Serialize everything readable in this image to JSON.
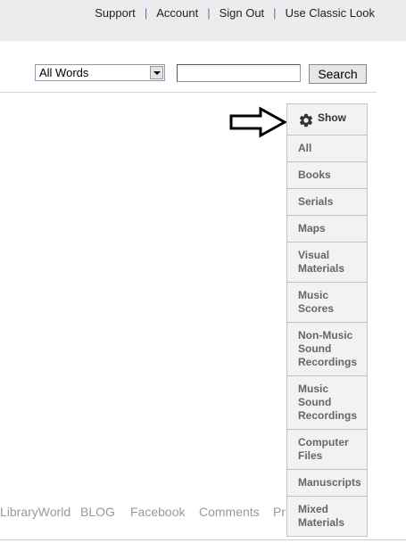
{
  "top_nav": {
    "links": [
      "Support",
      "Account",
      "Sign Out",
      "Use Classic Look"
    ],
    "separator": "|"
  },
  "search": {
    "type_selected": "All Words",
    "input_value": "",
    "button_label": "Search"
  },
  "show_panel": {
    "label": "Show",
    "icon": "gear-icon",
    "items": [
      {
        "label": "All"
      },
      {
        "label": "Books"
      },
      {
        "label": "Serials"
      },
      {
        "label": "Maps"
      },
      {
        "label": "Visual\nMaterials"
      },
      {
        "label": "Music\nScores"
      },
      {
        "label": "Non-Music\nSound\nRecordings"
      },
      {
        "label": "Music\nSound\nRecordings"
      },
      {
        "label": "Computer\nFiles"
      },
      {
        "label": "Manuscripts"
      },
      {
        "label": "Mixed\nMaterials"
      }
    ]
  },
  "footer": {
    "links": [
      "LibraryWorld",
      "BLOG",
      "Facebook",
      "Comments",
      "Pri"
    ]
  },
  "colors": {
    "topbar_bg": "#ececec",
    "separator": "#3a7bc8",
    "panel_bg": "#f2f2f2",
    "footer_text": "#999999"
  }
}
